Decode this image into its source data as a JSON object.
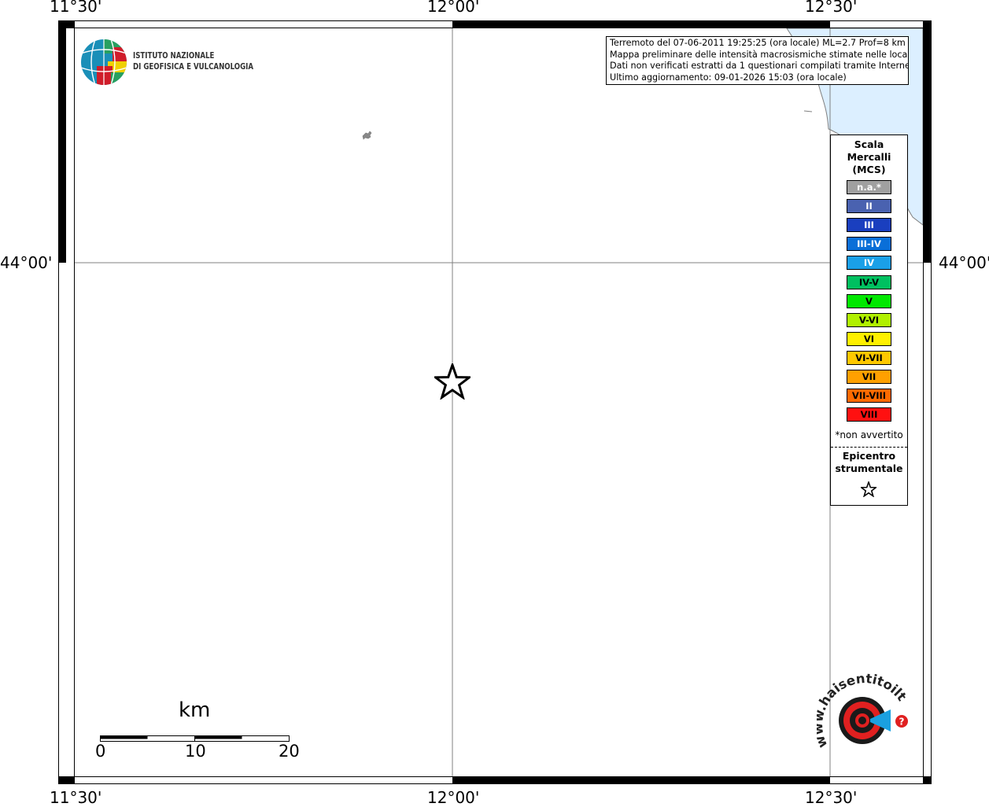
{
  "map": {
    "lon_labels": [
      "11°30'",
      "12°00'",
      "12°30'"
    ],
    "lat_labels": [
      "44°00'"
    ],
    "epicenter_symbol": "star-icon"
  },
  "institute": {
    "line1": "ISTITUTO NAZIONALE",
    "line2": "DI GEOFISICA E VULCANOLOGIA"
  },
  "info": {
    "line1": "Terremoto del 07-06-2011 19:25:25 (ora locale) ML=2.7 Prof=8 km",
    "line2": "Mappa preliminare delle intensità macrosismiche stimate nelle località",
    "line3": "Dati non verificati estratti da 1 questionari compilati tramite Internet.",
    "line4": "Ultimo aggiornamento: 09-01-2026 15:03 (ora locale)"
  },
  "legend": {
    "title1": "Scala",
    "title2": "Mercalli",
    "title3": "(MCS)",
    "items": [
      {
        "label": "n.a.*",
        "color": "#a0a0a0",
        "text_color": "#ffffff"
      },
      {
        "label": "II",
        "color": "#4a62b0",
        "text_color": "#ffffff"
      },
      {
        "label": "III",
        "color": "#1a3fbf",
        "text_color": "#ffffff"
      },
      {
        "label": "III-IV",
        "color": "#0a6fd8",
        "text_color": "#ffffff"
      },
      {
        "label": "IV",
        "color": "#1aa0e8",
        "text_color": "#ffffff"
      },
      {
        "label": "IV-V",
        "color": "#00c060",
        "text_color": "#000000"
      },
      {
        "label": "V",
        "color": "#00e800",
        "text_color": "#000000"
      },
      {
        "label": "V-VI",
        "color": "#b0f000",
        "text_color": "#000000"
      },
      {
        "label": "VI",
        "color": "#fff000",
        "text_color": "#000000"
      },
      {
        "label": "VI-VII",
        "color": "#ffc800",
        "text_color": "#000000"
      },
      {
        "label": "VII",
        "color": "#ffa000",
        "text_color": "#000000"
      },
      {
        "label": "VII-VIII",
        "color": "#ff6a00",
        "text_color": "#000000"
      },
      {
        "label": "VIII",
        "color": "#ff1010",
        "text_color": "#000000"
      }
    ],
    "note": "*non avvertito",
    "epi1": "Epicentro",
    "epi2": "strumentale"
  },
  "scale_bar": {
    "unit": "km",
    "ticks": [
      "0",
      "10",
      "20"
    ]
  },
  "haisentito": {
    "text": "www.haisentitoilterremoto.it"
  },
  "colors": {
    "sea": "#dcefff",
    "coast": "#808080"
  }
}
